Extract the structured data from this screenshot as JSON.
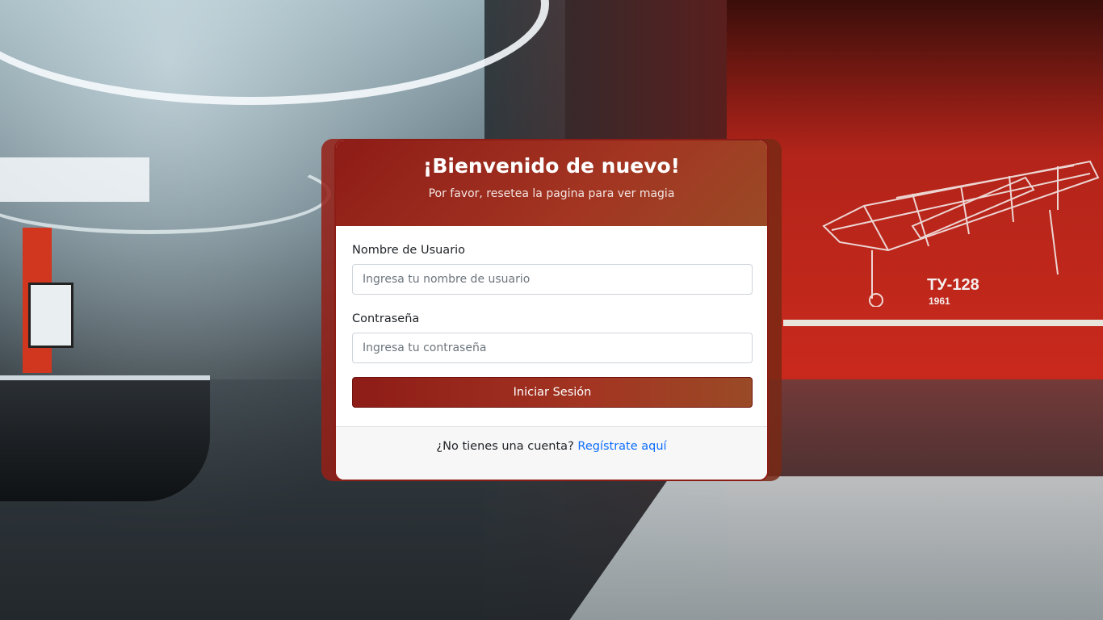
{
  "background": {
    "poster_label": "ТУ-128",
    "poster_year": "1961"
  },
  "login": {
    "title": "¡Bienvenido de nuevo!",
    "subtitle": "Por favor, resetea la pagina para ver magia",
    "username": {
      "label": "Nombre de Usuario",
      "placeholder": "Ingresa tu nombre de usuario",
      "value": ""
    },
    "password": {
      "label": "Contraseña",
      "placeholder": "Ingresa tu contraseña",
      "value": ""
    },
    "submit_label": "Iniciar Sesión",
    "footer_text": "¿No tienes una cuenta?",
    "register_link": "Regístrate aquí"
  },
  "colors": {
    "accent": "#a33522",
    "accent_dark": "#8e1c17",
    "link": "#0d6efd"
  }
}
